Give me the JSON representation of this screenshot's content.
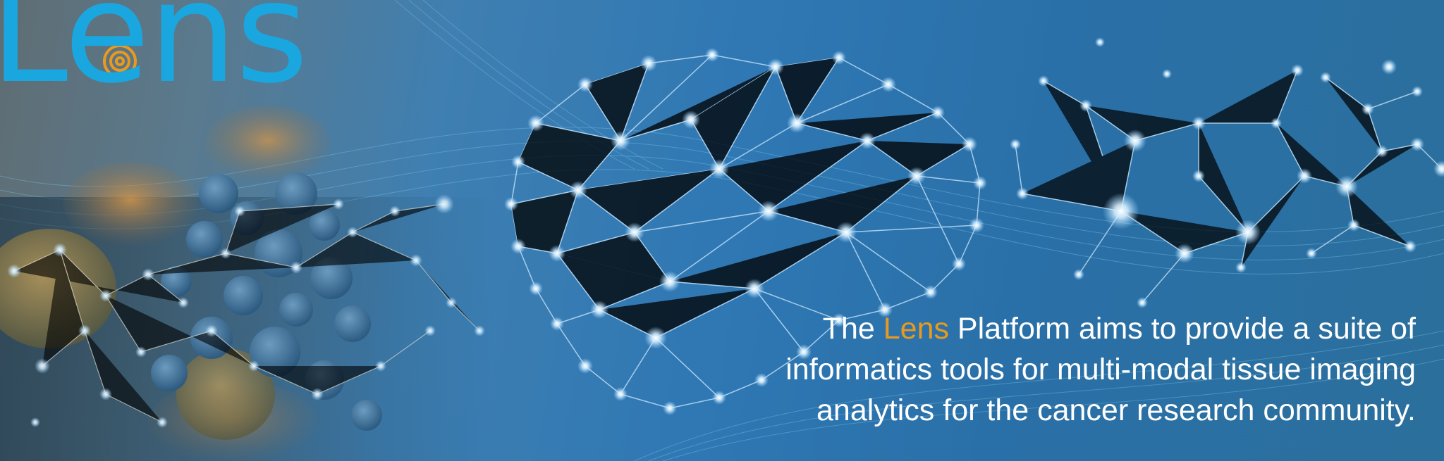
{
  "logo": {
    "text": "Lens"
  },
  "tagline": {
    "prefix": "The ",
    "highlight": "Lens",
    "line1_rest": " Platform aims to provide a suite of",
    "line2": "informatics tools for multi-modal tissue imaging",
    "line3": "analytics for the cancer research community."
  },
  "colors": {
    "logo": "#1aa7df",
    "highlight": "#e89a1e",
    "text": "#ffffff",
    "node_glow": "#cfeaff"
  },
  "icons": [
    "brain-network-icon",
    "molecule-network-icon",
    "cell-cluster-icon"
  ]
}
